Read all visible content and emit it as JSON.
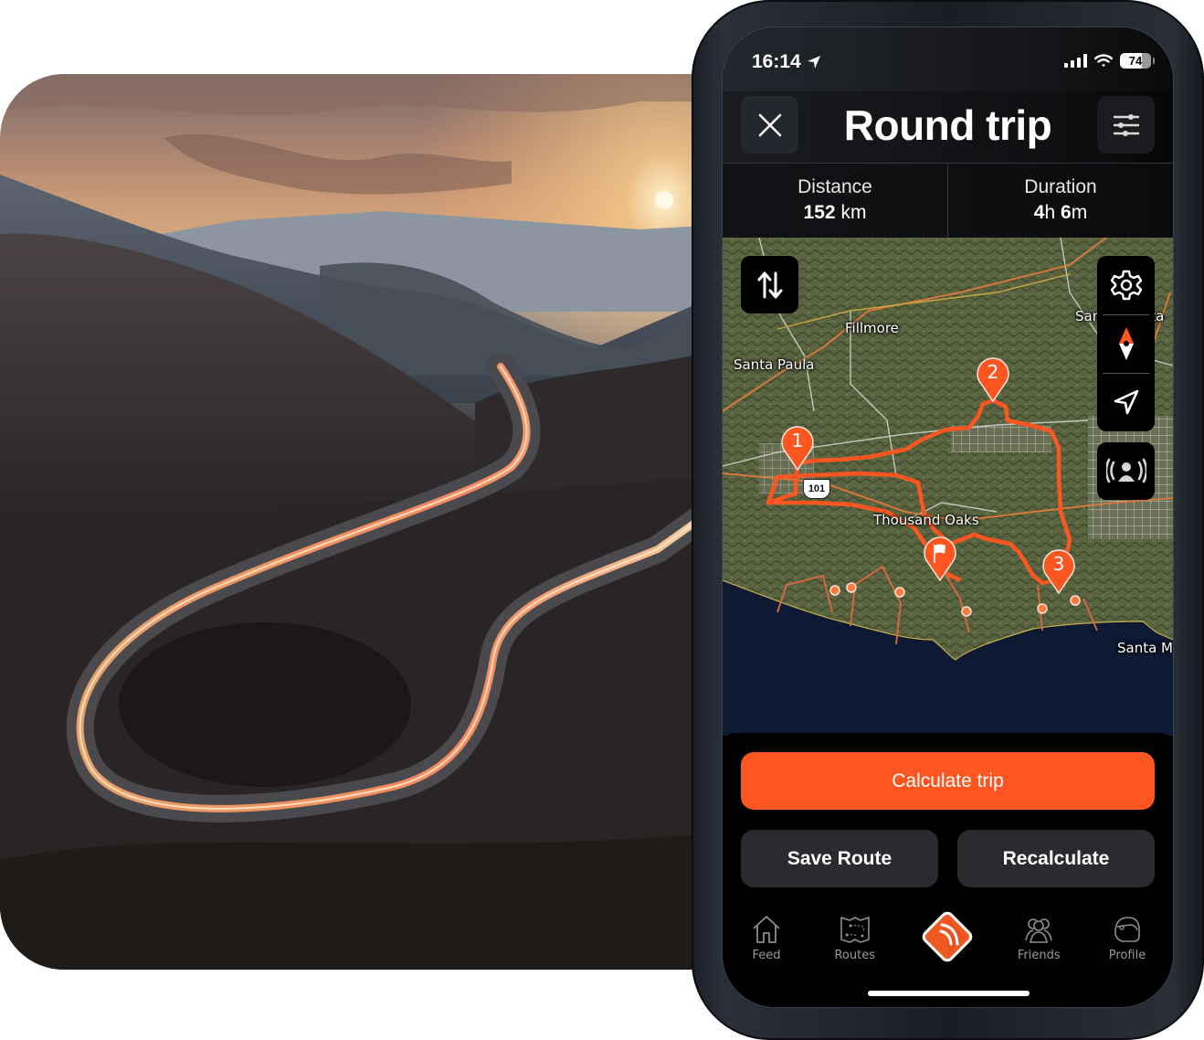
{
  "status_bar": {
    "time": "16:14",
    "battery": "74",
    "icons": [
      "location-arrow-icon",
      "signal-icon",
      "wifi-icon",
      "battery-icon"
    ]
  },
  "header": {
    "title": "Round trip",
    "close_icon": "close-icon",
    "filter_icon": "sliders-icon"
  },
  "stats": {
    "distance_label": "Distance",
    "distance_value": "152",
    "distance_unit": "km",
    "duration_label": "Duration",
    "duration_hours": "4",
    "duration_hours_unit": "h",
    "duration_minutes": "6",
    "duration_minutes_unit": "m"
  },
  "map": {
    "labels": {
      "fillmore": "Fillmore",
      "santa_paula": "Santa Paula",
      "santa_clarita": "Santa Clarita",
      "thousand_oaks": "Thousand Oaks",
      "santa_monica": "Santa Monica"
    },
    "highway_shield": "101",
    "waypoints": [
      "1",
      "2",
      "3"
    ],
    "controls": [
      "swap-icon",
      "gear-icon",
      "compass-icon",
      "locate-icon",
      "broadcast-icon"
    ],
    "route_color": "#fe5621"
  },
  "actions": {
    "calculate": "Calculate trip",
    "save": "Save Route",
    "recalculate": "Recalculate"
  },
  "tabs": [
    {
      "label": "Feed",
      "icon": "home-icon"
    },
    {
      "label": "Routes",
      "icon": "map-icon"
    },
    {
      "label": "",
      "icon": "app-logo-icon"
    },
    {
      "label": "Friends",
      "icon": "friends-icon"
    },
    {
      "label": "Profile",
      "icon": "helmet-icon"
    }
  ],
  "colors": {
    "accent": "#fe5621",
    "button_dark": "#2a2b2f",
    "background": "#000000"
  }
}
